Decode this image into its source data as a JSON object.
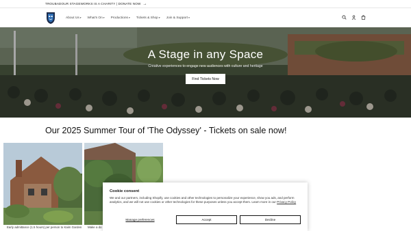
{
  "announcement": {
    "text": "TROUBADOUR STAGEWORKS IS A CHARITY | DONATE NOW",
    "arrow_icon": "arrow-right-icon"
  },
  "header": {
    "logo_icon": "theatre-mask-logo",
    "nav": [
      {
        "label": "About Us",
        "has_dropdown": true
      },
      {
        "label": "What's On",
        "has_dropdown": true
      },
      {
        "label": "Productions",
        "has_dropdown": true
      },
      {
        "label": "Tickets & Shop",
        "has_dropdown": true
      },
      {
        "label": "Join & Support",
        "has_dropdown": true
      }
    ],
    "icons": [
      "search-icon",
      "account-icon",
      "cart-icon"
    ]
  },
  "hero": {
    "title": "A Stage in any Space",
    "subtitle": "Creative experiences to engage new audiences with culture and heritage",
    "button_label": "Find Tickets Now"
  },
  "section": {
    "title": "Our 2025 Summer Tour of 'The Odyssey' - Tickets on sale now!"
  },
  "cards": [
    {
      "caption": "Early admittance (1.5 hours) per person to Kaim Garden"
    },
    {
      "caption": "Make a do"
    }
  ],
  "cookie": {
    "title": "Cookie consent",
    "body": "We and our partners, including Shopify, use cookies and other technologies to personalize your experience, show you ads, and perform analytics, and we will not use cookies or other technologies for these purposes unless you accept them. Learn more in our",
    "link_text": "Privacy Policy",
    "manage_label": "Manage preferences",
    "accept_label": "Accept",
    "decline_label": "Decline"
  }
}
